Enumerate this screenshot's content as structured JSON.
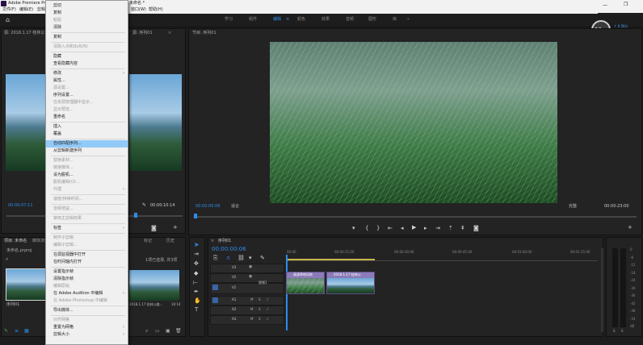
{
  "titlebar": {
    "app_title": "Adobe Premiere Pr",
    "doc_title": "未命名 *"
  },
  "menubar": {
    "items": [
      "文件(F)",
      "编辑(E)",
      "剪辑"
    ],
    "right_items": [
      "窗口(W)",
      "帮助(H)"
    ]
  },
  "workspaces": [
    "学习",
    "组件",
    "编辑",
    "颜色",
    "效果",
    "音频",
    "图形",
    "库"
  ],
  "active_workspace": "编辑",
  "badge": {
    "value": "50",
    "unit": "%",
    "up": "0.5",
    "up_unit": "K/s",
    "down": "0",
    "down_unit": "K/s"
  },
  "source_panel": {
    "tab": "源: 2018.1.17 桂林公",
    "right_tab": "源: 序列01",
    "timecode_left": "00:00:07:11",
    "timecode_right": "00:00:10:14"
  },
  "program_panel": {
    "tab": "节目: 序列01",
    "timecode": "00:00:00:06",
    "fit": "适合",
    "quality": "完整",
    "duration": "00:00:23:00"
  },
  "project_panel": {
    "tab": "项目: 未命名",
    "tab2": "媒体浏览",
    "file": "未命名.prproj",
    "right_tab1": "标记",
    "right_tab2": "历史",
    "count": "1项已选择, 共3项",
    "thumb1_label": "序列01",
    "thumb2_label": "2018.1.17 桂林公路...",
    "thumb2_duration": "10:14"
  },
  "timeline": {
    "tab": "序列01",
    "timecode": "00:00:00:06",
    "ruler": [
      "00:00",
      "00:00:15:00",
      "00:00:30:00",
      "00:00:45:00",
      "00:01:00:00",
      "00:01:15:00"
    ],
    "video_tracks": [
      "V3",
      "V2",
      "V1"
    ],
    "audio_tracks": [
      "A1",
      "A2",
      "A3"
    ],
    "track_name": "视频1",
    "clip1": "高清草地风吹",
    "clip2": "2018.1.17 桂林公",
    "meter_labels": [
      "0",
      "-6",
      "-12",
      "-18",
      "-24",
      "-30",
      "-36",
      "-42",
      "-48",
      "-54",
      "dB"
    ],
    "meter_bottom": [
      "S",
      "S"
    ]
  },
  "context_menu": {
    "items": [
      {
        "label": "剪切",
        "enabled": true
      },
      {
        "label": "复制",
        "enabled": true
      },
      {
        "label": "粘贴",
        "enabled": false
      },
      {
        "label": "清除",
        "enabled": true
      },
      {
        "sep": true
      },
      {
        "label": "复制",
        "enabled": true
      },
      {
        "sep": true
      },
      {
        "label": "清除入点和出点(N)",
        "enabled": false
      },
      {
        "sep": true
      },
      {
        "label": "隐藏",
        "enabled": true
      },
      {
        "label": "查看隐藏内容",
        "enabled": true
      },
      {
        "sep": true
      },
      {
        "label": "修改",
        "enabled": true,
        "submenu": true
      },
      {
        "label": "属性...",
        "enabled": true
      },
      {
        "label": "源设置...",
        "enabled": false
      },
      {
        "label": "序列设置...",
        "enabled": true
      },
      {
        "label": "在资源管理器中显示...",
        "enabled": false
      },
      {
        "label": "显示预览...",
        "enabled": false
      },
      {
        "label": "重命名",
        "enabled": true
      },
      {
        "sep": true
      },
      {
        "label": "插入",
        "enabled": true
      },
      {
        "label": "覆盖",
        "enabled": true
      },
      {
        "sep": true
      },
      {
        "label": "自动匹配序列...",
        "enabled": true,
        "highlighted": true
      },
      {
        "label": "从剪辑新建序列",
        "enabled": true
      },
      {
        "sep": true
      },
      {
        "label": "替换素材...",
        "enabled": false
      },
      {
        "label": "链接媒体...",
        "enabled": false
      },
      {
        "label": "设为脱机...",
        "enabled": true
      },
      {
        "label": "脱机编辑(O)...",
        "enabled": false
      },
      {
        "label": "代理",
        "enabled": false,
        "submenu": true
      },
      {
        "sep": true
      },
      {
        "label": "速度/持续时间...",
        "enabled": false
      },
      {
        "sep": true
      },
      {
        "label": "音频增益...",
        "enabled": false
      },
      {
        "sep": true
      },
      {
        "label": "禁用主剪辑效果",
        "enabled": false
      },
      {
        "sep": true
      },
      {
        "label": "标签",
        "enabled": true,
        "submenu": true
      },
      {
        "sep": true
      },
      {
        "label": "制作子剪辑",
        "enabled": false
      },
      {
        "label": "编辑子剪辑...",
        "enabled": false
      },
      {
        "sep": true
      },
      {
        "label": "在源监视器中打开",
        "enabled": true
      },
      {
        "label": "在时间轴内打开",
        "enabled": true
      },
      {
        "sep": true
      },
      {
        "label": "设置指示帧",
        "enabled": true
      },
      {
        "label": "清除指示帧",
        "enabled": true
      },
      {
        "label": "编辑原始",
        "enabled": false
      },
      {
        "label": "在 Adobe Audition 中编辑",
        "enabled": true,
        "submenu": true
      },
      {
        "label": "在 Adobe Photoshop 中编辑",
        "enabled": false
      },
      {
        "sep": true
      },
      {
        "label": "导出媒体...",
        "enabled": true
      },
      {
        "sep": true
      },
      {
        "label": "对齐网格",
        "enabled": false
      },
      {
        "label": "重置为网格",
        "enabled": true,
        "submenu": true
      },
      {
        "label": "剪辑大小",
        "enabled": true,
        "submenu": true
      }
    ]
  }
}
